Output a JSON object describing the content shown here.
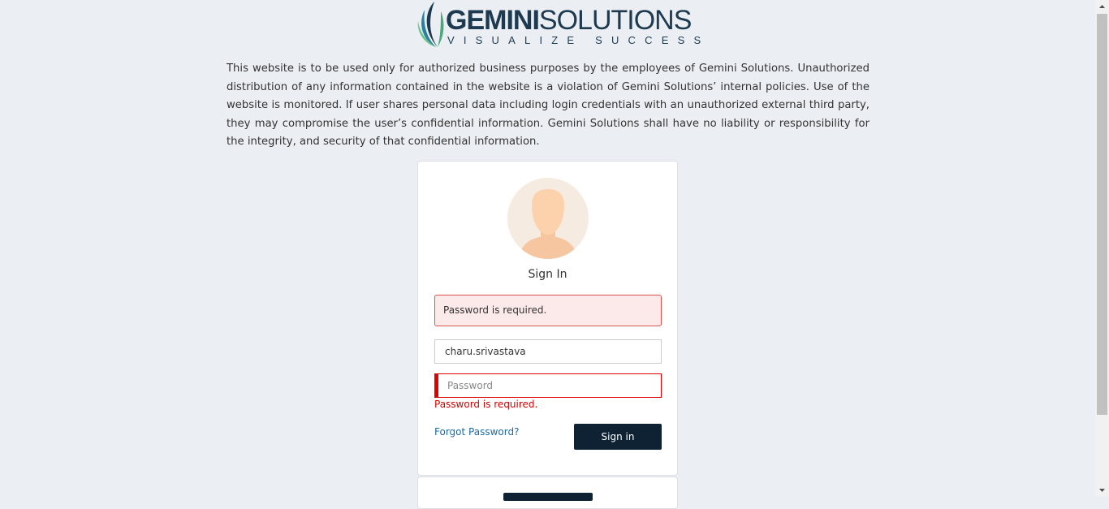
{
  "brand": {
    "name_bold": "GEMINI",
    "name_light": "SOLUTIONS",
    "tagline": "VISUALIZE SUCCESS",
    "colors": {
      "navy": "#1d3a50",
      "teal": "#2a7fa0",
      "green": "#6cc38c"
    }
  },
  "disclaimer": "This website is to be used only for authorized business purposes by the employees of Gemini Solutions. Unauthorized distribution of any information contained in the website is a violation of Gemini Solutions’ internal policies. Use of the website is monitored. If user shares personal data including login credentials with an unauthorized external third party, they may compromise the user’s confidential information. Gemini Solutions shall have no liability or responsibility for the integrity, and security of that confidential information.",
  "login": {
    "avatar_icon": "user-avatar-icon",
    "title": "Sign In",
    "alert": "Password is required.",
    "username_value": "charu.srivastava",
    "password_placeholder": "Password",
    "password_error": "Password is required.",
    "forgot_link": "Forgot Password?",
    "signin_button": "Sign in"
  },
  "colors": {
    "background": "#ebeef3",
    "primary_button": "#0e2233",
    "error": "#d50000",
    "link": "#1f6aa5"
  }
}
